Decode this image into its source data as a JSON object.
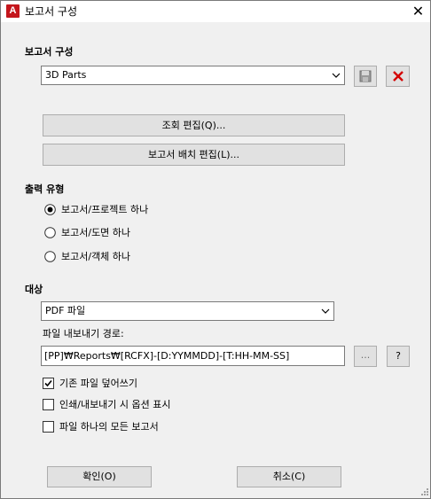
{
  "window": {
    "title": "보고서 구성",
    "app_icon_letter": "A"
  },
  "report_config": {
    "heading": "보고서 구성",
    "selected": "3D Parts",
    "edit_query_label": "조회 편집(Q)...",
    "edit_layout_label": "보고서 배치 편집(L)..."
  },
  "output_type": {
    "heading": "출력 유형",
    "options": [
      {
        "label": "보고서/프로젝트 하나",
        "checked": true
      },
      {
        "label": "보고서/도면 하나",
        "checked": false
      },
      {
        "label": "보고서/객체 하나",
        "checked": false
      }
    ]
  },
  "target": {
    "heading": "대상",
    "format": "PDF 파일",
    "path_label": "파일 내보내기 경로:",
    "path_value": "[PP]₩Reports₩[RCFX]-[D:YYMMDD]-[T:HH-MM-SS]",
    "browse_label": "...",
    "help_label": "?",
    "checkboxes": [
      {
        "label": "기존 파일 덮어쓰기",
        "checked": true
      },
      {
        "label": "인쇄/내보내기 시 옵션 표시",
        "checked": false
      },
      {
        "label": "파일 하나의 모든 보고서",
        "checked": false
      }
    ]
  },
  "footer": {
    "ok_label": "확인(O)",
    "cancel_label": "취소(C)"
  },
  "colors": {
    "delete_x": "#d40000",
    "radio_dot": "#000000"
  }
}
